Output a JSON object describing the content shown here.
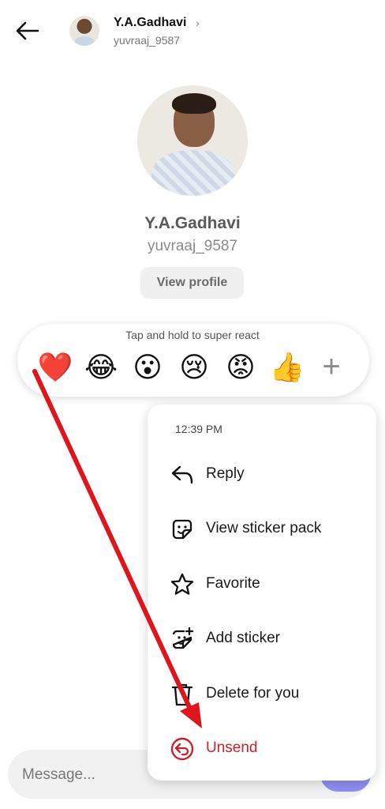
{
  "header": {
    "back_icon": "arrow-left-icon",
    "name": "Y.A.Gadhavi",
    "chevron": "›",
    "username": "yuvraaj_9587"
  },
  "profile": {
    "name": "Y.A.Gadhavi",
    "username": "yuvraaj_9587",
    "view_profile_label": "View profile"
  },
  "reactions": {
    "hint": "Tap and hold to super react",
    "emojis": [
      "❤️",
      "😂",
      "😮",
      "😢",
      "😡",
      "👍"
    ],
    "more_label": "+"
  },
  "menu": {
    "time": "12:39 PM",
    "items": [
      {
        "label": "Reply",
        "icon": "reply-icon"
      },
      {
        "label": "View sticker pack",
        "icon": "sticker-icon"
      },
      {
        "label": "Favorite",
        "icon": "star-icon"
      },
      {
        "label": "Add sticker",
        "icon": "add-sticker-icon"
      },
      {
        "label": "Delete for you",
        "icon": "trash-icon"
      },
      {
        "label": "Unsend",
        "icon": "unsend-icon"
      }
    ]
  },
  "composer": {
    "placeholder": "Message..."
  },
  "colors": {
    "danger": "#d01e2a",
    "annotation_arrow": "#e0141c",
    "send_button": "#8f8ef2"
  }
}
